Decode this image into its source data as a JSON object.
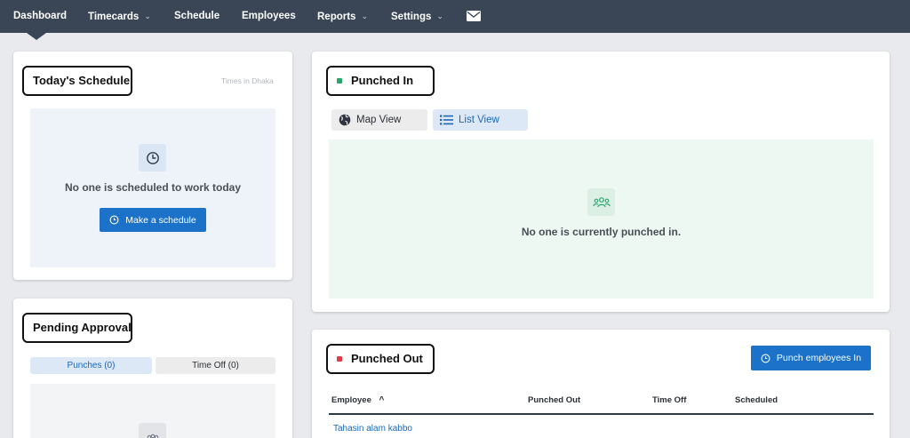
{
  "nav": {
    "items": [
      {
        "label": "Dashboard",
        "dropdown": false
      },
      {
        "label": "Timecards",
        "dropdown": true
      },
      {
        "label": "Schedule",
        "dropdown": false
      },
      {
        "label": "Employees",
        "dropdown": false
      },
      {
        "label": "Reports",
        "dropdown": true
      },
      {
        "label": "Settings",
        "dropdown": true
      }
    ],
    "active": "Dashboard",
    "mail_icon": "envelope-icon"
  },
  "todays_schedule": {
    "title": "Today's Schedule",
    "timezone_note": "Times in Dhaka",
    "empty_icon": "clock-icon",
    "empty_text": "No one is scheduled to work today",
    "button_label": "Make a schedule"
  },
  "pending_approval": {
    "title": "Pending Approval",
    "tabs": [
      {
        "label": "Punches (0)",
        "active": true
      },
      {
        "label": "Time Off (0)",
        "active": false
      }
    ]
  },
  "punched_in": {
    "title": "Punched In",
    "status_color": "#27a56b",
    "view_toggle": [
      {
        "label": "Map View",
        "icon": "globe-icon",
        "active": false
      },
      {
        "label": "List View",
        "icon": "list-icon",
        "active": true
      }
    ],
    "empty_icon": "users-icon",
    "empty_text": "No one is currently punched in."
  },
  "punched_out": {
    "title": "Punched Out",
    "status_color": "#e23c4a",
    "button_label": "Punch employees In",
    "columns": [
      "Employee",
      "Punched Out",
      "Time Off",
      "Scheduled"
    ],
    "sort_indicator": "^",
    "rows": [
      {
        "employee": "Tahasin alam kabbo",
        "punched_out": "",
        "time_off": "",
        "scheduled": ""
      }
    ]
  },
  "colors": {
    "nav_bg": "#3a4655",
    "primary": "#1b72c8",
    "page_bg": "#e9eaee"
  }
}
